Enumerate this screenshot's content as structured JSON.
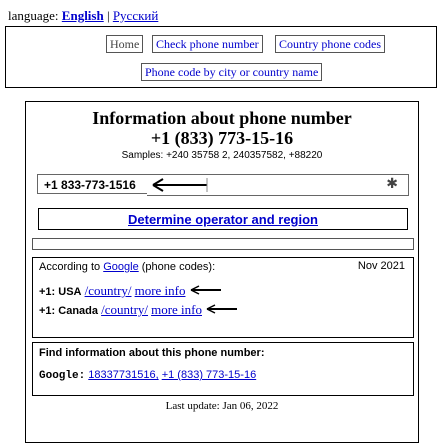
{
  "language_bar": {
    "label": "language:",
    "current": "English",
    "separator": "|",
    "other": "Русский"
  },
  "nav": {
    "home": "Home",
    "check": "Check phone number",
    "country_codes": "Country phone codes",
    "city_codes": "Phone code by city or country name"
  },
  "main": {
    "title_line1": "Information about phone number",
    "title_line2": "+1 (833) 773-15-16",
    "samples": "Samples: +240 35758 2, 240357582, +88220",
    "input_value": "+1 833-773-1516",
    "clear_icon": "close-icon",
    "determine_button": "Determine operator and region",
    "google_box": {
      "prefix": "According to",
      "link": "Google",
      "suffix": "(phone codes):",
      "date": "Nov 2021",
      "entries": [
        {
          "code": "+1:",
          "country": "USA",
          "path": "/country/",
          "more": "more info"
        },
        {
          "code": "+1:",
          "country": "Canada",
          "path": "/country/",
          "more": "more info"
        }
      ]
    },
    "find_box": {
      "title": "Find information about this phone number:",
      "engine": "Google:",
      "query1": "18337731516,",
      "query2": "+1 (833) 773-15-16"
    },
    "last_update": "Last update: Jan 06, 2022"
  },
  "colors": {
    "link": "#0000cc",
    "border": "#000000"
  }
}
